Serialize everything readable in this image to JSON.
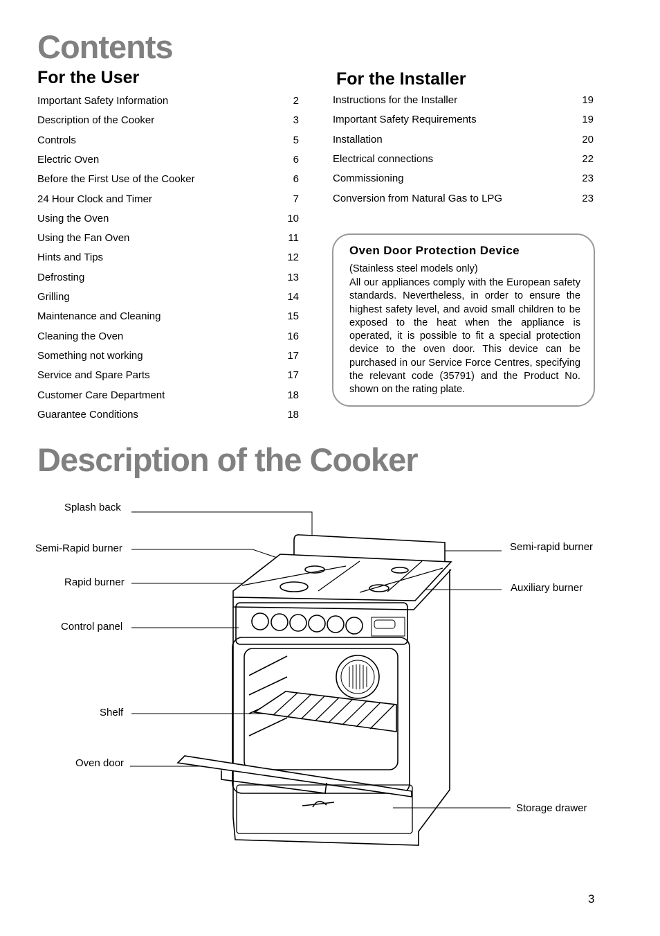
{
  "contents_title": "Contents",
  "user": {
    "title": "For the User",
    "items": [
      {
        "label": "Important Safety Information",
        "page": "2"
      },
      {
        "label": "Description of the Cooker",
        "page": "3"
      },
      {
        "label": "Controls",
        "page": "5"
      },
      {
        "label": "Electric Oven",
        "page": "6"
      },
      {
        "label": "Before the First Use of the Cooker",
        "page": "6"
      },
      {
        "label": "24 Hour Clock and Timer",
        "page": "7"
      },
      {
        "label": "Using the Oven",
        "page": "10"
      },
      {
        "label": "Using the Fan Oven",
        "page": "11"
      },
      {
        "label": "Hints and Tips",
        "page": "12"
      },
      {
        "label": "Defrosting",
        "page": "13"
      },
      {
        "label": "Grilling",
        "page": "14"
      },
      {
        "label": "Maintenance and Cleaning",
        "page": "15"
      },
      {
        "label": "Cleaning the Oven",
        "page": "16"
      },
      {
        "label": "Something not working",
        "page": "17"
      },
      {
        "label": "Service and Spare Parts",
        "page": "17"
      },
      {
        "label": "Customer Care Department",
        "page": "18"
      },
      {
        "label": "Guarantee Conditions",
        "page": "18"
      }
    ]
  },
  "installer": {
    "title": "For the Installer",
    "items": [
      {
        "label": "Instructions for the Installer",
        "page": "19"
      },
      {
        "label": "Important Safety Requirements",
        "page": "19"
      },
      {
        "label": "Installation",
        "page": "20"
      },
      {
        "label": "Electrical connections",
        "page": "22"
      },
      {
        "label": "Commissioning",
        "page": "23"
      },
      {
        "label": "Conversion from Natural Gas to LPG",
        "page": "23"
      }
    ]
  },
  "notice": {
    "title": "Oven Door Protection Device",
    "subtitle": "(Stainless steel models only)",
    "body": "All our appliances comply with the European safety standards. Nevertheless, in order to ensure the highest safety level, and avoid small children to be exposed to the heat when the appliance is operated, it is possible to fit a special protection device to the oven door. This device can be purchased in our Service Force Centres, specifying the relevant code (35791) and the Product No. shown on the rating plate."
  },
  "description_title": "Description of the Cooker",
  "diagram": {
    "labels": {
      "splash_back": "Splash back",
      "semi_rapid_left": "Semi-Rapid burner",
      "rapid": "Rapid burner",
      "control_panel": "Control panel",
      "shelf": "Shelf",
      "oven_door": "Oven door",
      "semi_rapid_right": "Semi-rapid burner",
      "auxiliary": "Auxiliary burner",
      "storage_drawer": "Storage drawer"
    }
  },
  "page_number": "3",
  "colors": {
    "heading": "#808080",
    "box_border": "#999999"
  }
}
